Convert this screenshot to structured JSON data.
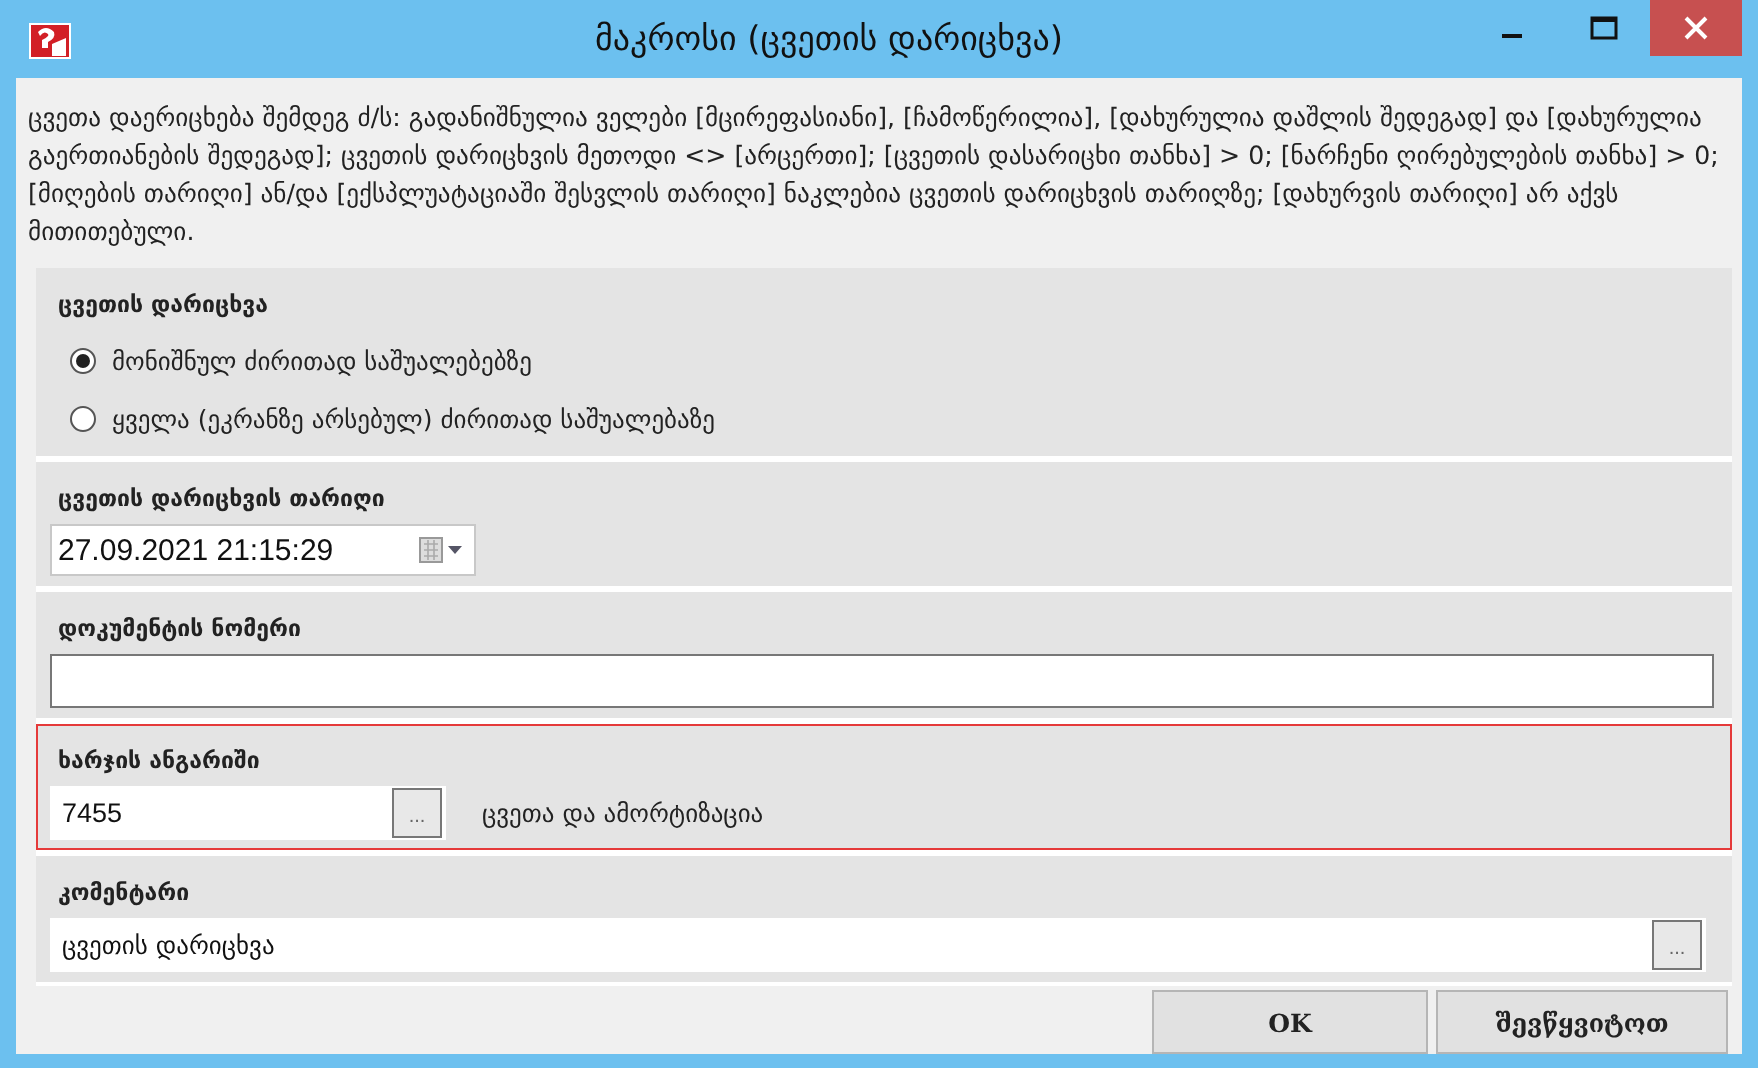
{
  "window": {
    "title": "მაკროსი (ცვეთის დარიცხვა)"
  },
  "description": "ცვეთა დაერიცხება შემდეგ ძ/ს: გადანიშნულია ველები [მცირეფასიანი], [ჩამოწერილია], [დახურულია დაშლის შედეგად] და [დახურულია გაერთიანების შედეგად]; ცვეთის დარიცხვის მეთოდი <> [არცერთი]; [ცვეთის დასარიცხი თანხა] > 0; [ნარჩენი ღირებულების თანხა] > 0; [მიღების თარიღი] ან/და [ექსპლუატაციაში შესვლის თარიღი] ნაკლებია ცვეთის დარიცხვის თარიღზე; [დახურვის თარიღი] არ აქვს მითითებული.",
  "sections": [
    {
      "kind": "radio",
      "label": "ცვეთის დარიცხვა",
      "options": [
        {
          "label": "მონიშნულ ძირითად საშუალებებზე",
          "selected": true
        },
        {
          "label": "ყველა (ეკრანზე არსებულ) ძირითად საშუალებაზე",
          "selected": false
        }
      ]
    },
    {
      "kind": "date",
      "label": "ცვეთის დარიცხვის თარიღი",
      "value": "27.09.2021 21:15:29"
    },
    {
      "kind": "text",
      "label": "დოკუმენტის ნომერი"
    },
    {
      "kind": "lookup",
      "label": "ხარჯის ანგარიში",
      "value": "7455",
      "button": "...",
      "caption": "ცვეთა და ამორტიზაცია",
      "highlighted": true
    },
    {
      "kind": "lookup-wide",
      "label": "კომენტარი",
      "value": "ცვეთის დარიცხვა",
      "button": "...",
      "highlighted": false
    }
  ],
  "buttons": [
    "OK",
    "შევწყვიტოთ"
  ]
}
